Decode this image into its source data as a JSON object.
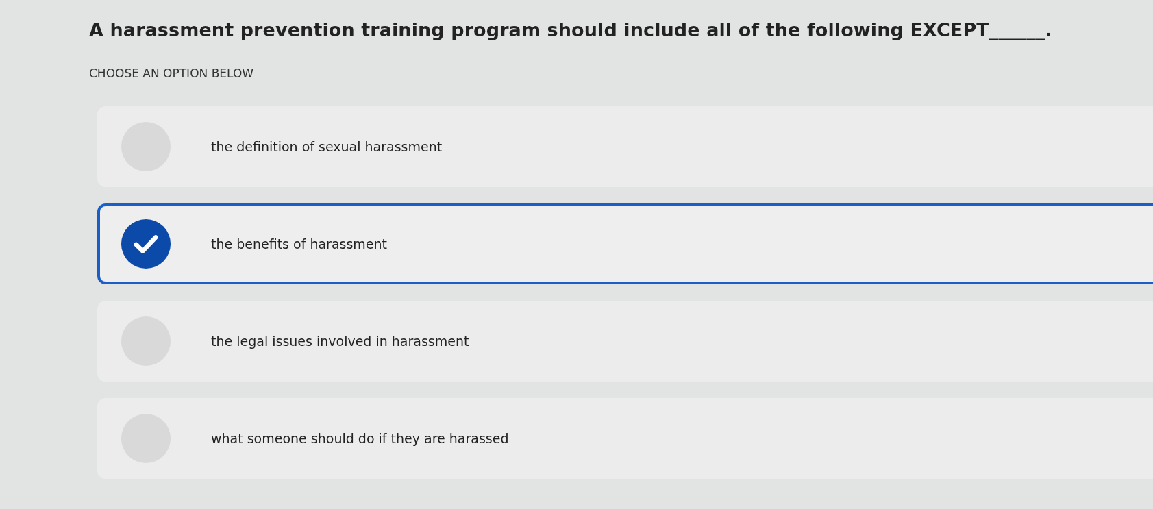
{
  "question": "A harassment prevention training program should include all of the following EXCEPT______.",
  "instruction": "CHOOSE AN OPTION BELOW",
  "options": [
    {
      "label": "the definition of sexual harassment",
      "selected": false
    },
    {
      "label": "the benefits of harassment",
      "selected": true
    },
    {
      "label": "the legal issues involved in harassment",
      "selected": false
    },
    {
      "label": "what someone should do if they are harassed",
      "selected": false
    }
  ]
}
